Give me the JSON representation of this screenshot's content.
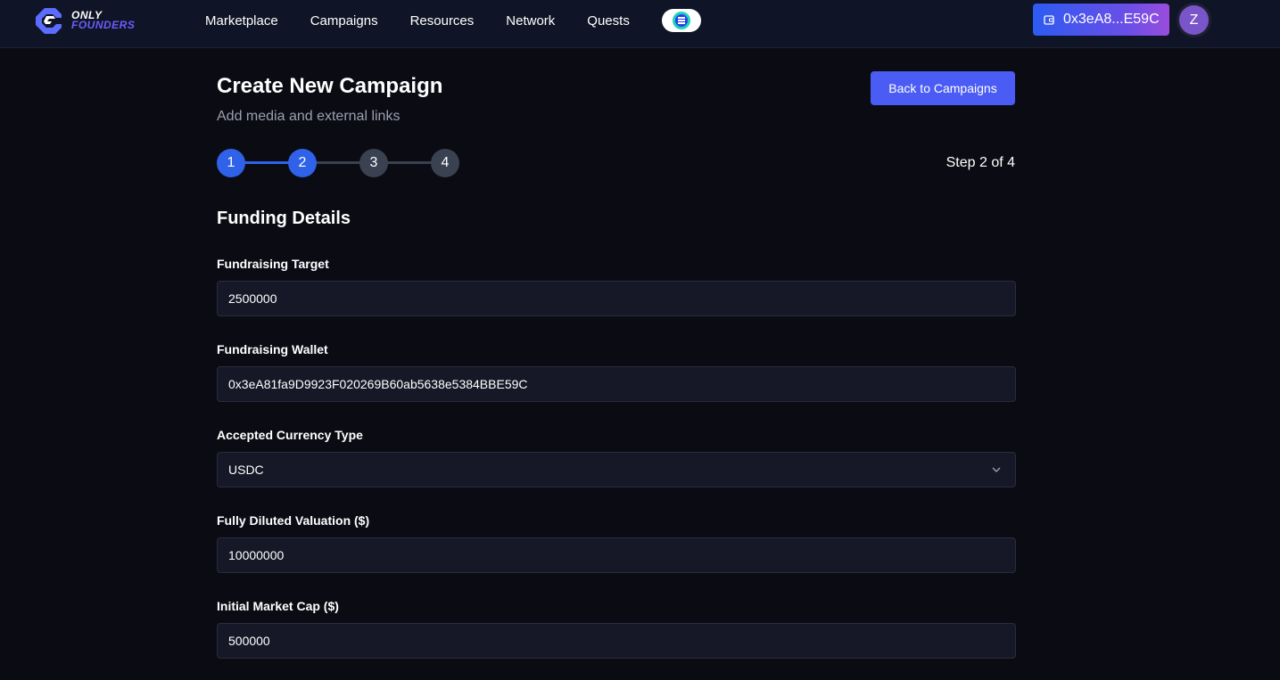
{
  "brand": {
    "line1": "ONLY",
    "line2": "FOUNDERS",
    "accent": "#6b5cff"
  },
  "nav": {
    "items": [
      "Marketplace",
      "Campaigns",
      "Resources",
      "Network",
      "Quests"
    ],
    "pill_icon": "chain-logo-icon"
  },
  "wallet": {
    "address_short": "0x3eA8...E59C",
    "icon": "wallet-icon"
  },
  "user": {
    "avatar_initial": "Z"
  },
  "page": {
    "title": "Create New Campaign",
    "subtitle": "Add media and external links",
    "back_button": "Back to Campaigns",
    "step_count": "Step 2 of 4",
    "current_step": 2,
    "steps": [
      "1",
      "2",
      "3",
      "4"
    ]
  },
  "form": {
    "section_title": "Funding Details",
    "fields": [
      {
        "label": "Fundraising Target",
        "value": "2500000",
        "type": "input"
      },
      {
        "label": "Fundraising Wallet",
        "value": "0x3eA81fa9D9923F020269B60ab5638e5384BBE59C",
        "type": "input"
      },
      {
        "label": "Accepted Currency Type",
        "value": "USDC",
        "type": "select"
      },
      {
        "label": "Fully Diluted Valuation ($)",
        "value": "10000000",
        "type": "input"
      },
      {
        "label": "Initial Market Cap ($)",
        "value": "500000",
        "type": "input"
      }
    ]
  },
  "colors": {
    "background": "#0b0b14",
    "topbar": "#0f1526",
    "primary": "#4a5cf4",
    "step_active": "#2f62e8",
    "step_inactive": "#3a4150",
    "field_bg": "#171827"
  }
}
